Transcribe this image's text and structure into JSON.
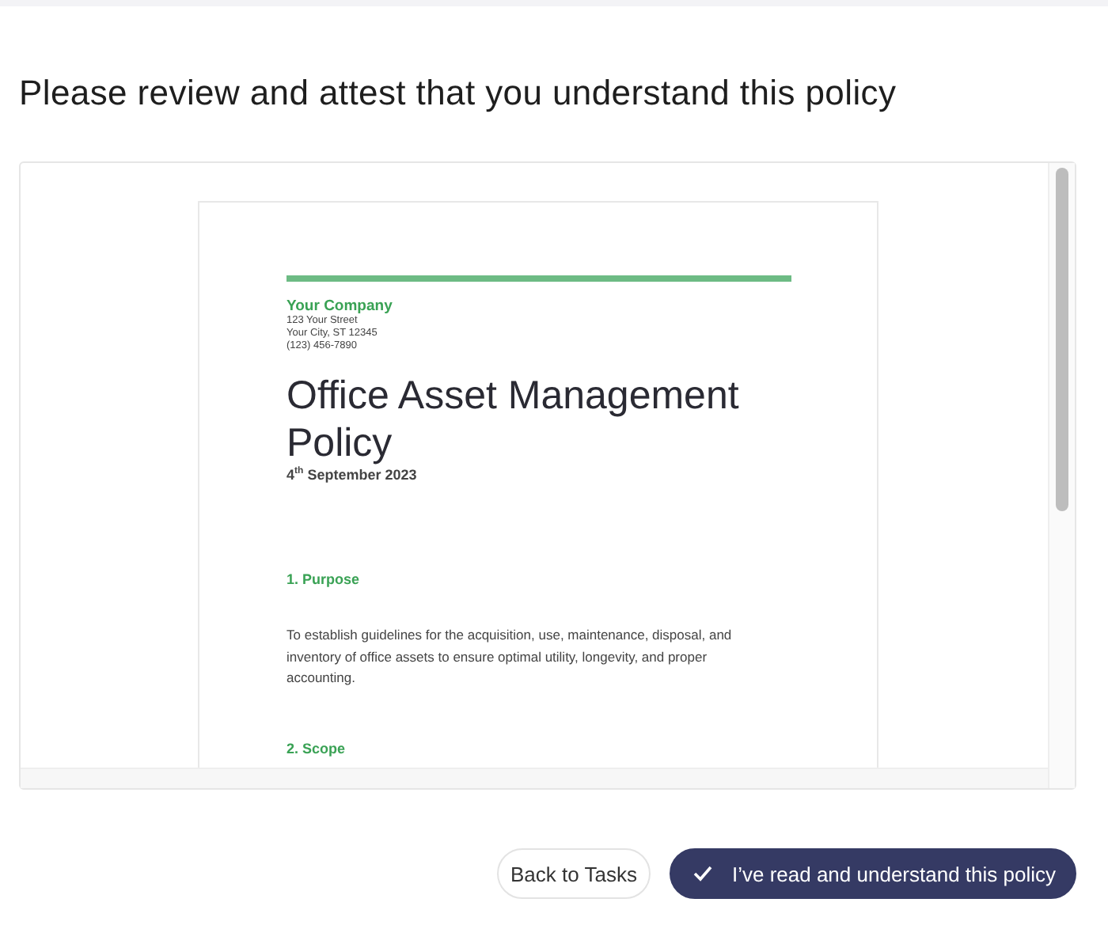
{
  "heading": "Please review and attest that you understand this policy",
  "document": {
    "company": "Your Company",
    "address_lines": [
      "123 Your Street",
      "Your City, ST 12345",
      "(123) 456-7890"
    ],
    "title": "Office Asset Management Policy",
    "date": "4$^{th}$ September 2023",
    "sections": [
      {
        "heading": "1. Purpose",
        "body": "To establish guidelines for the acquisition, use, maintenance, disposal, and inventory of office assets to ensure optimal utility, longevity, and proper accounting."
      },
      {
        "heading": "2. Scope"
      }
    ]
  },
  "buttons": [
    {
      "label": "Back to Tasks",
      "kind": "secondary"
    },
    {
      "label": "I’ve read and understand this policy",
      "kind": "primary"
    }
  ]
}
